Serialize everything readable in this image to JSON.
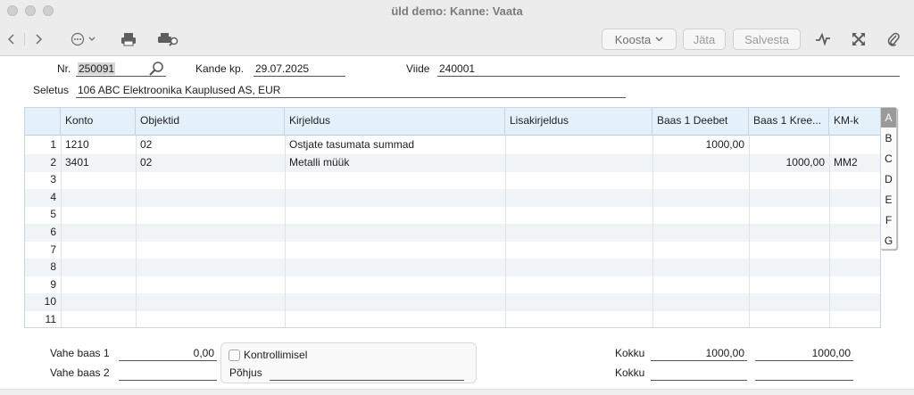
{
  "window": {
    "title": "üld demo: Kanne: Vaata"
  },
  "toolbar": {
    "koosta_label": "Koosta",
    "jata_label": "Jäta",
    "salvesta_label": "Salvesta"
  },
  "header": {
    "nr_label": "Nr.",
    "nr_value": "250091",
    "kande_kp_label": "Kande kp.",
    "kande_kp_value": "29.07.2025",
    "viide_label": "Viide",
    "viide_value": "240001",
    "seletus_label": "Seletus",
    "seletus_value": "106 ABC Elektroonika Kauplused AS, EUR"
  },
  "grid": {
    "columns": [
      "Konto",
      "Objektid",
      "Kirjeldus",
      "Lisakirjeldus",
      "Baas 1 Deebet",
      "Baas 1 Kree...",
      "KM-k"
    ],
    "rows": [
      {
        "n": "1",
        "konto": "1210",
        "objektid": "02",
        "kirjeldus": "Ostjate tasumata summad",
        "lisakirjeldus": "",
        "deebet": "1000,00",
        "kreedit": "",
        "kmk": ""
      },
      {
        "n": "2",
        "konto": "3401",
        "objektid": "02",
        "kirjeldus": "Metalli müük",
        "lisakirjeldus": "",
        "deebet": "",
        "kreedit": "1000,00",
        "kmk": "MM2"
      },
      {
        "n": "3",
        "konto": "",
        "objektid": "",
        "kirjeldus": "",
        "lisakirjeldus": "",
        "deebet": "",
        "kreedit": "",
        "kmk": ""
      },
      {
        "n": "4",
        "konto": "",
        "objektid": "",
        "kirjeldus": "",
        "lisakirjeldus": "",
        "deebet": "",
        "kreedit": "",
        "kmk": ""
      },
      {
        "n": "5",
        "konto": "",
        "objektid": "",
        "kirjeldus": "",
        "lisakirjeldus": "",
        "deebet": "",
        "kreedit": "",
        "kmk": ""
      },
      {
        "n": "6",
        "konto": "",
        "objektid": "",
        "kirjeldus": "",
        "lisakirjeldus": "",
        "deebet": "",
        "kreedit": "",
        "kmk": ""
      },
      {
        "n": "7",
        "konto": "",
        "objektid": "",
        "kirjeldus": "",
        "lisakirjeldus": "",
        "deebet": "",
        "kreedit": "",
        "kmk": ""
      },
      {
        "n": "8",
        "konto": "",
        "objektid": "",
        "kirjeldus": "",
        "lisakirjeldus": "",
        "deebet": "",
        "kreedit": "",
        "kmk": ""
      },
      {
        "n": "9",
        "konto": "",
        "objektid": "",
        "kirjeldus": "",
        "lisakirjeldus": "",
        "deebet": "",
        "kreedit": "",
        "kmk": ""
      },
      {
        "n": "10",
        "konto": "",
        "objektid": "",
        "kirjeldus": "",
        "lisakirjeldus": "",
        "deebet": "",
        "kreedit": "",
        "kmk": ""
      },
      {
        "n": "11",
        "konto": "",
        "objektid": "",
        "kirjeldus": "",
        "lisakirjeldus": "",
        "deebet": "",
        "kreedit": "",
        "kmk": ""
      }
    ]
  },
  "side_tabs": [
    "A",
    "B",
    "C",
    "D",
    "E",
    "F",
    "G"
  ],
  "footer": {
    "vahe_baas_1_label": "Vahe baas 1",
    "vahe_baas_1_value": "0,00",
    "vahe_baas_2_label": "Vahe baas 2",
    "vahe_baas_2_value": "",
    "kontrollimisel_label": "Kontrollimisel",
    "pohjus_label": "Põhjus",
    "pohjus_value": "",
    "kokku_label_1": "Kokku",
    "kokku_deebet": "1000,00",
    "kokku_kreedit": "1000,00",
    "kokku_label_2": "Kokku",
    "kokku2_deebet": "",
    "kokku2_kreedit": ""
  },
  "icons": [
    "back-icon",
    "forward-icon",
    "more-icon",
    "print-icon",
    "print-preview-icon",
    "activity-icon",
    "expand-icon",
    "attachment-icon",
    "search-icon"
  ]
}
